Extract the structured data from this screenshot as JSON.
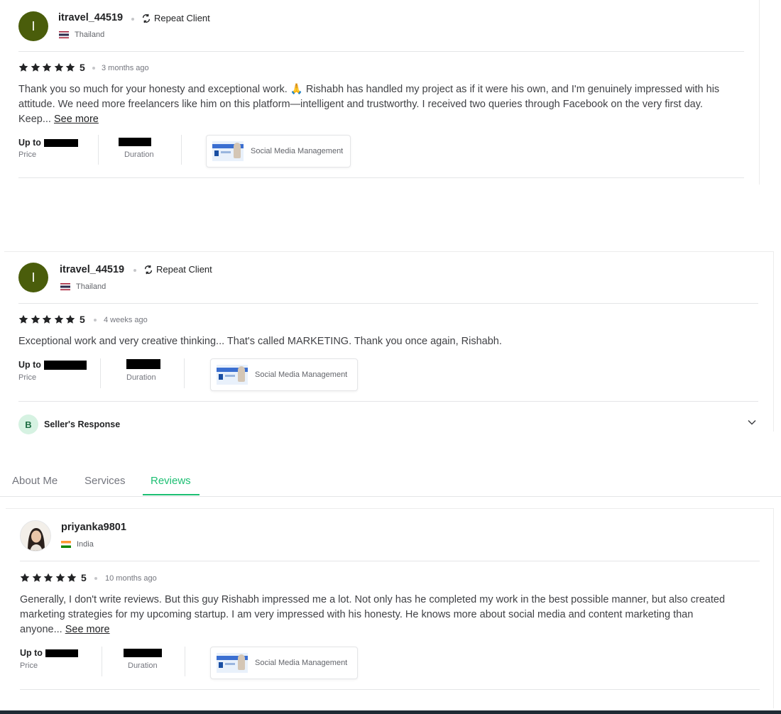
{
  "reviews": [
    {
      "avatar_letter": "I",
      "username": "itravel_44519",
      "badge": "Repeat Client",
      "country": "Thailand",
      "rating": "5",
      "time": "3 months ago",
      "text": "Thank you so much for your honesty and exceptional work. 🙏 Rishabh has handled my project as if it were his own, and I'm genuinely impressed with his attitude. We need more freelancers like him on this platform—intelligent and trustworthy. I received two queries through Facebook on the very first day. Keep...",
      "see_more": "See more",
      "price_prefix": "Up to",
      "price_label": "Price",
      "duration_label": "Duration",
      "gig": "Social Media Management"
    },
    {
      "avatar_letter": "I",
      "username": "itravel_44519",
      "badge": "Repeat Client",
      "country": "Thailand",
      "rating": "5",
      "time": "4 weeks ago",
      "text": "Exceptional work and very creative thinking... That's called MARKETING. Thank you once again, Rishabh.",
      "price_prefix": "Up to",
      "price_label": "Price",
      "duration_label": "Duration",
      "gig": "Social Media Management",
      "response_badge": "B",
      "response_label": "Seller's Response"
    },
    {
      "username": "priyanka9801",
      "country": "India",
      "rating": "5",
      "time": "10 months ago",
      "text": "Generally, I don't write reviews. But this guy Rishabh impressed me a lot. Not only has he completed my work in the best possible manner, but also created marketing strategies for my upcoming startup. I am very impressed with his honesty. He knows more about social media and content marketing than anyone...",
      "see_more": "See more",
      "price_prefix": "Up to",
      "price_label": "Price",
      "duration_label": "Duration",
      "gig": "Social Media Management"
    }
  ],
  "tabs": [
    "About Me",
    "Services",
    "Reviews"
  ],
  "active_tab": "Reviews",
  "colors": {
    "accent": "#1dbf73",
    "avatar": "#4a5d0b",
    "star": "#222325"
  }
}
